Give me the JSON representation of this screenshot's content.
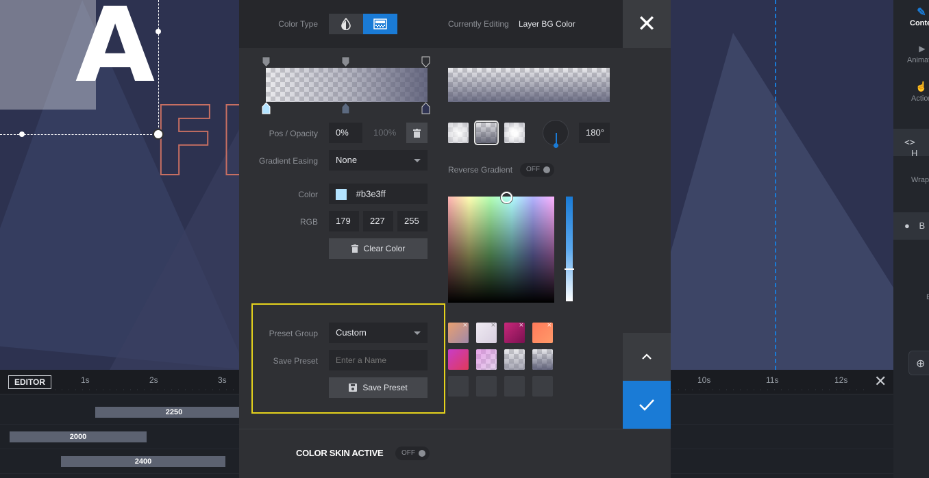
{
  "canvas": {
    "big_text": "ACR",
    "outline_text": "FI"
  },
  "right_sidebar": {
    "items": [
      {
        "label": "Content",
        "icon": "pencil-icon"
      },
      {
        "label": "Animation",
        "icon": "play-icon"
      },
      {
        "label": "Actions",
        "icon": "hand-icon"
      }
    ],
    "row1": {
      "icon": "code-icon",
      "label": "H"
    },
    "wrap_label": "Wrap",
    "row2": {
      "icon": "palette-icon",
      "label": "B"
    },
    "b_label": "B",
    "globe_icon": "globe-icon"
  },
  "timeline": {
    "editor_label": "EDITOR",
    "ticks_left": [
      "1s",
      "2s",
      "3s"
    ],
    "ticks_right": [
      "10s",
      "11s",
      "12s"
    ],
    "bars": [
      "2250",
      "2000",
      "2400"
    ]
  },
  "modal": {
    "color_type_label": "Color Type",
    "currently_editing_label": "Currently Editing",
    "currently_editing_value": "Layer BG Color",
    "pos_opacity_label": "Pos / Opacity",
    "pos_value": "0%",
    "opacity_value": "100%",
    "angle_value": "180°",
    "gradient_easing_label": "Gradient Easing",
    "gradient_easing_value": "None",
    "reverse_gradient_label": "Reverse Gradient",
    "reverse_gradient_state": "OFF",
    "color_label": "Color",
    "color_value": "#b3e3ff",
    "color_hex": "#b3e3ff",
    "rgb_label": "RGB",
    "rgb_r": "179",
    "rgb_g": "227",
    "rgb_b": "255",
    "clear_color_label": "Clear Color",
    "preset_group_label": "Preset Group",
    "preset_group_value": "Custom",
    "save_preset_label": "Save Preset",
    "save_preset_placeholder": "Enter a Name",
    "save_preset_button": "Save Preset",
    "color_skin_label": "COLOR SKIN ACTIVE",
    "color_skin_state": "OFF"
  },
  "colors": {
    "accent": "#1a7bd6",
    "highlight_box": "#e6d31c"
  }
}
